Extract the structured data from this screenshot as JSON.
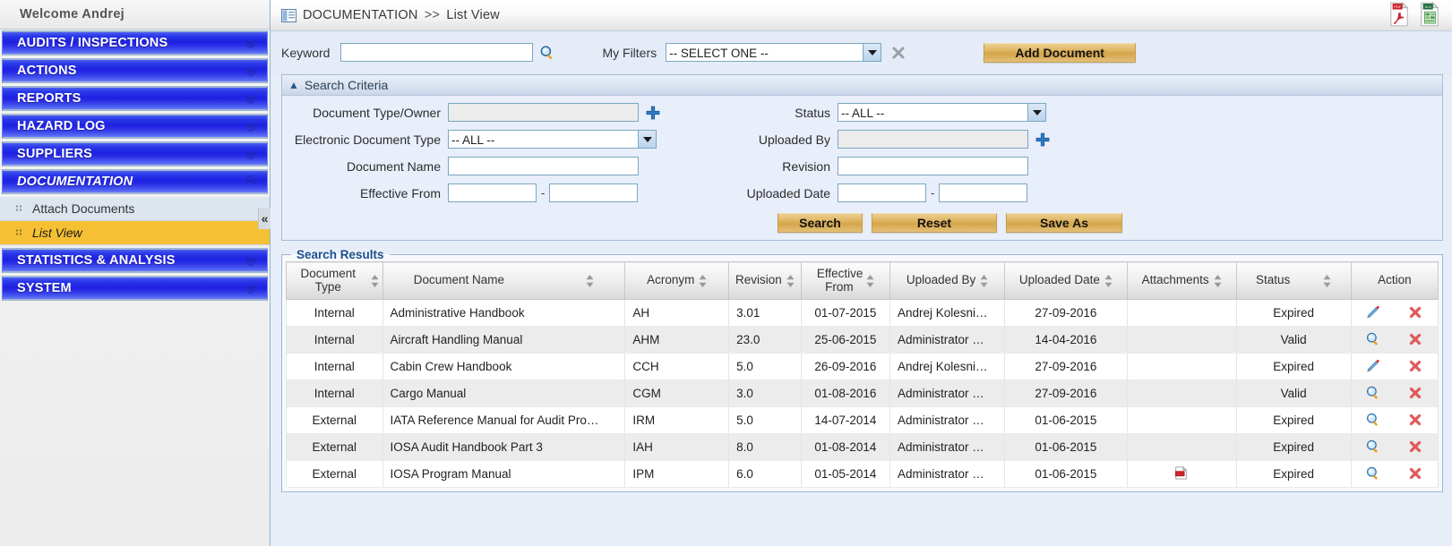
{
  "sidebar": {
    "welcome": "Welcome  Andrej",
    "items": [
      {
        "label": "AUDITS / INSPECTIONS",
        "state": "collapsed"
      },
      {
        "label": "ACTIONS",
        "state": "collapsed"
      },
      {
        "label": "REPORTS",
        "state": "collapsed"
      },
      {
        "label": "HAZARD LOG",
        "state": "collapsed"
      },
      {
        "label": "SUPPLIERS",
        "state": "collapsed"
      },
      {
        "label": "DOCUMENTATION",
        "state": "expanded"
      },
      {
        "label": "STATISTICS & ANALYSIS",
        "state": "collapsed"
      },
      {
        "label": "SYSTEM",
        "state": "collapsed"
      }
    ],
    "submenu": [
      {
        "label": "Attach Documents",
        "active": false
      },
      {
        "label": "List View",
        "active": true
      }
    ],
    "collapse_glyph": "«",
    "active_color": "#f5c033",
    "menu_color": "#2a2fe6"
  },
  "topbar": {
    "breadcrumb_root": "DOCUMENTATION",
    "breadcrumb_sep": ">>",
    "breadcrumb_leaf": "List View",
    "export_pdf_label": "PDF",
    "export_xls_label": "XLS"
  },
  "filterbar": {
    "keyword_label": "Keyword",
    "keyword_value": "",
    "keyword_placeholder": "",
    "my_filters_label": "My Filters",
    "my_filters_value": "-- SELECT ONE --",
    "add_document_label": "Add Document"
  },
  "search_criteria": {
    "title": "Search Criteria",
    "left": [
      {
        "label": "Document Type/Owner",
        "value": "",
        "type": "lookup"
      },
      {
        "label": "Electronic Document Type",
        "value": "-- ALL --",
        "type": "select"
      },
      {
        "label": "Document Name",
        "value": "",
        "type": "text"
      },
      {
        "label": "Effective From",
        "value": "",
        "value2": "",
        "type": "daterange",
        "separator": "-"
      }
    ],
    "right": [
      {
        "label": "Status",
        "value": "-- ALL --",
        "type": "select"
      },
      {
        "label": "Uploaded By",
        "value": "",
        "type": "lookup"
      },
      {
        "label": "Revision",
        "value": "",
        "type": "text"
      },
      {
        "label": "Uploaded Date",
        "value": "",
        "value2": "",
        "type": "daterange",
        "separator": "-"
      }
    ],
    "buttons": {
      "search": "Search",
      "reset": "Reset",
      "save_as": "Save As"
    }
  },
  "results": {
    "legend": "Search Results",
    "columns": [
      {
        "label": "Document Type",
        "sortable": true
      },
      {
        "label": "Document Name",
        "sortable": true
      },
      {
        "label": "Acronym",
        "sortable": true
      },
      {
        "label": "Revision",
        "sortable": true
      },
      {
        "label": "Effective From",
        "sortable": true
      },
      {
        "label": "Uploaded By",
        "sortable": true
      },
      {
        "label": "Uploaded Date",
        "sortable": true
      },
      {
        "label": "Attachments",
        "sortable": true
      },
      {
        "label": "Status",
        "sortable": true
      },
      {
        "label": "Action",
        "sortable": false
      }
    ],
    "rows": [
      {
        "document_type": "Internal",
        "document_name": "Administrative Handbook",
        "acronym": "AH",
        "revision": "3.01",
        "effective_from": "01-07-2015",
        "uploaded_by": "Andrej Kolesni…",
        "uploaded_date": "27-09-2016",
        "attachment": "",
        "status": "Expired",
        "action_primary": "edit-icon",
        "action_secondary": "delete-icon"
      },
      {
        "document_type": "Internal",
        "document_name": "Aircraft Handling Manual",
        "acronym": "AHM",
        "revision": "23.0",
        "effective_from": "25-06-2015",
        "uploaded_by": "Administrator …",
        "uploaded_date": "14-04-2016",
        "attachment": "",
        "status": "Valid",
        "action_primary": "view-icon",
        "action_secondary": "delete-icon"
      },
      {
        "document_type": "Internal",
        "document_name": "Cabin Crew Handbook",
        "acronym": "CCH",
        "revision": "5.0",
        "effective_from": "26-09-2016",
        "uploaded_by": "Andrej Kolesni…",
        "uploaded_date": "27-09-2016",
        "attachment": "",
        "status": "Expired",
        "action_primary": "edit-icon",
        "action_secondary": "delete-icon"
      },
      {
        "document_type": "Internal",
        "document_name": "Cargo Manual",
        "acronym": "CGM",
        "revision": "3.0",
        "effective_from": "01-08-2016",
        "uploaded_by": "Administrator …",
        "uploaded_date": "27-09-2016",
        "attachment": "",
        "status": "Valid",
        "action_primary": "view-icon",
        "action_secondary": "delete-icon"
      },
      {
        "document_type": "External",
        "document_name": "IATA Reference Manual for Audit Pro…",
        "acronym": "IRM",
        "revision": "5.0",
        "effective_from": "14-07-2014",
        "uploaded_by": "Administrator …",
        "uploaded_date": "01-06-2015",
        "attachment": "",
        "status": "Expired",
        "action_primary": "view-icon",
        "action_secondary": "delete-icon"
      },
      {
        "document_type": "External",
        "document_name": "IOSA Audit Handbook Part 3",
        "acronym": "IAH",
        "revision": "8.0",
        "effective_from": "01-08-2014",
        "uploaded_by": "Administrator …",
        "uploaded_date": "01-06-2015",
        "attachment": "",
        "status": "Expired",
        "action_primary": "view-icon",
        "action_secondary": "delete-icon"
      },
      {
        "document_type": "External",
        "document_name": "IOSA Program Manual",
        "acronym": "IPM",
        "revision": "6.0",
        "effective_from": "01-05-2014",
        "uploaded_by": "Administrator …",
        "uploaded_date": "01-06-2015",
        "attachment": "pdf-attachment-icon",
        "status": "Expired",
        "action_primary": "view-icon",
        "action_secondary": "delete-icon"
      }
    ]
  }
}
